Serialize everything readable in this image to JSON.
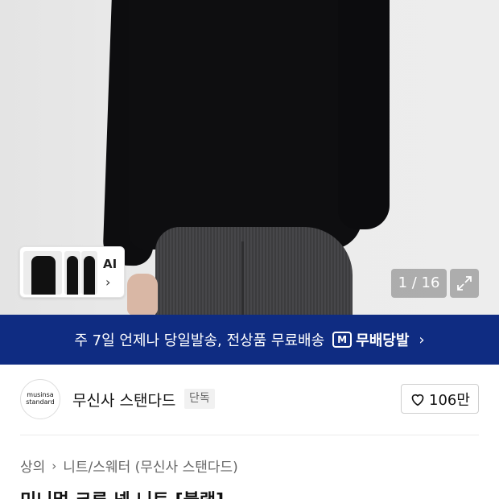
{
  "hero": {
    "counter": "1 / 16",
    "ai_label": "AI"
  },
  "banner": {
    "text": "주 7일 언제나 당일발송, 전상품 무료배송",
    "logo_mark": "M",
    "logo_text": "무배당발"
  },
  "brand": {
    "logo_line1": "musinsa",
    "logo_line2": "standard",
    "name": "무신사 스탠다드",
    "badge": "단독",
    "likes": "106만"
  },
  "breadcrumb": {
    "category": "상의",
    "subcategory": "니트/스웨터 (무신사 스탠다드)"
  },
  "product": {
    "title": "미니멀 크루 넥 니트 [블랙]"
  }
}
